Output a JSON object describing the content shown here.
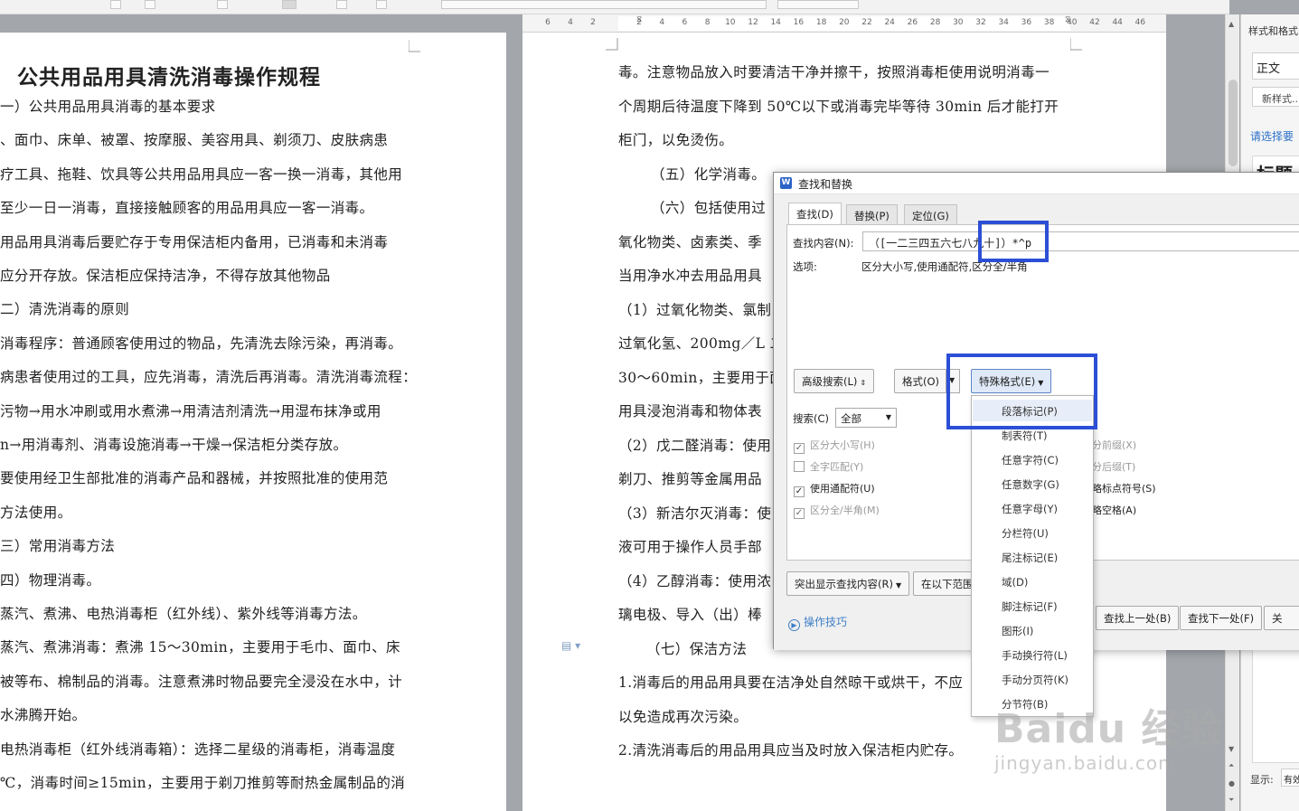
{
  "ruler": {
    "ticks": [
      "6",
      "4",
      "2",
      "2",
      "4",
      "6",
      "8",
      "10",
      "12",
      "14",
      "16",
      "18",
      "20",
      "22",
      "24",
      "26",
      "28",
      "30",
      "32",
      "34",
      "36",
      "38",
      "40",
      "42",
      "44",
      "46"
    ]
  },
  "left_page": {
    "title": "公共用品用具清洗消毒操作规程",
    "lines": [
      "一）公共用品用具消毒的基本要求",
      "、面巾、床单、被罩、按摩服、美容用具、剃须刀、皮肤病患",
      "疗工具、拖鞋、饮具等公共用品用具应一客一换一消毒，其他用",
      "至少一日一消毒，直接接触顾客的用品用具应一客一消毒。",
      "用品用具消毒后要贮存于专用保洁柜内备用，已消毒和未消毒",
      "应分开存放。保洁柜应保持洁净，不得存放其他物品",
      "二）清洗消毒的原则",
      "消毒程序：普通顾客使用过的物品，先清洗去除污染，再消毒。",
      "病患者使用过的工具，应先消毒，清洗后再消毒。清洗消毒流程：",
      "污物→用水冲刷或用水煮沸→用清洁剂清洗→用湿布抹净或用",
      "n→用消毒剂、消毒设施消毒→干燥→保洁柜分类存放。",
      "要使用经卫生部批准的消毒产品和器械，并按照批准的使用范",
      "方法使用。",
      "三）常用消毒方法",
      "四）物理消毒。",
      "蒸汽、煮沸、电热消毒柜（红外线）、紫外线等消毒方法。",
      "蒸汽、煮沸消毒：煮沸 15～30min，主要用于毛巾、面巾、床",
      "被等布、棉制品的消毒。注意煮沸时物品要完全浸没在水中，计",
      "水沸腾开始。",
      "电热消毒柜（红外线消毒箱）：选择二星级的消毒柜，消毒温度",
      "℃，消毒时间≥15min，主要用于剃刀推剪等耐热金属制品的消"
    ]
  },
  "right_page": {
    "lines": [
      "毒。注意物品放入时要清洁干净并擦干，按照消毒柜使用说明消毒一",
      "个周期后待温度下降到 50℃以下或消毒完毕等待 30min 后才能打开",
      "柜门，以免烫伤。",
      "（五）化学消毒。",
      "（六）包括使用过",
      "氧化物类、卤素类、季",
      "当用净水冲去用品用具",
      "（1）过氧化物类、氯制",
      "过氧化氢、200mg／L 二",
      "30～60min，主要用于面",
      "用具浸泡消毒和物体表",
      "（2）戊二醛消毒：使用",
      "剃刀、推剪等金属用品",
      "（3）新洁尔灭消毒：使",
      "液可用于操作人员手部",
      "（4）乙醇消毒：使用浓",
      "璃电极、导入（出）棒",
      "（七）保洁方法",
      "1.消毒后的用品用具要在洁净处自然晾干或烘干，不应",
      "以免造成再次污染。",
      "2.清洗消毒后的用品用具应当及时放入保洁柜内贮存。"
    ]
  },
  "side_panel": {
    "title": "样式和格式",
    "current_style": "正文",
    "new_style_label": "新样式...",
    "hint": "请选择要",
    "heading_preview": "标题",
    "show_label": "显示:",
    "show_value": "有效"
  },
  "dialog": {
    "title": "查找和替换",
    "tabs": [
      "查找(D)",
      "替换(P)",
      "定位(G)"
    ],
    "find_label": "查找内容(N):",
    "find_value": "（[一二三四五六七八九十]）*^p",
    "options_label": "选项:",
    "options_value": "区分大小写,使用通配符,区分全/半角",
    "advanced_search": "高级搜索(L)",
    "format": "格式(O)",
    "special_format": "特殊格式(E)",
    "search_label": "搜索(C)",
    "search_value": "全部",
    "checkboxes_left": [
      {
        "label": "区分大小写(H)",
        "checked": true,
        "enabled": false
      },
      {
        "label": "全字匹配(Y)",
        "checked": false,
        "enabled": false
      },
      {
        "label": "使用通配符(U)",
        "checked": true,
        "enabled": true
      },
      {
        "label": "区分全/半角(M)",
        "checked": true,
        "enabled": false
      }
    ],
    "checkboxes_right": [
      {
        "label": "分前缀(X)",
        "enabled": false
      },
      {
        "label": "分后缀(T)",
        "enabled": false
      },
      {
        "label": "略标点符号(S)",
        "enabled": true
      },
      {
        "label": "略空格(A)",
        "enabled": true
      }
    ],
    "highlight_btn": "突出显示查找内容(R)",
    "in_range_btn": "在以下范围",
    "tips": "操作技巧",
    "find_prev": "查找上一处(B)",
    "find_next": "查找下一处(F)",
    "close": "关"
  },
  "special_menu": {
    "items": [
      "段落标记(P)",
      "制表符(T)",
      "任意字符(C)",
      "任意数字(G)",
      "任意字母(Y)",
      "分栏符(U)",
      "尾注标记(E)",
      "域(D)",
      "脚注标记(F)",
      "图形(I)",
      "手动换行符(L)",
      "手动分页符(K)",
      "分节符(B)"
    ],
    "highlighted": "段落标记(P)"
  },
  "watermark": {
    "line1": "Baidu 经验",
    "line2": "jingyan.baidu.com"
  },
  "colors": {
    "highlight_box": "#2c4fd6",
    "link_blue": "#3f7fc7",
    "page_bg": "#ffffff",
    "workspace_bg": "#a3a6ab"
  }
}
